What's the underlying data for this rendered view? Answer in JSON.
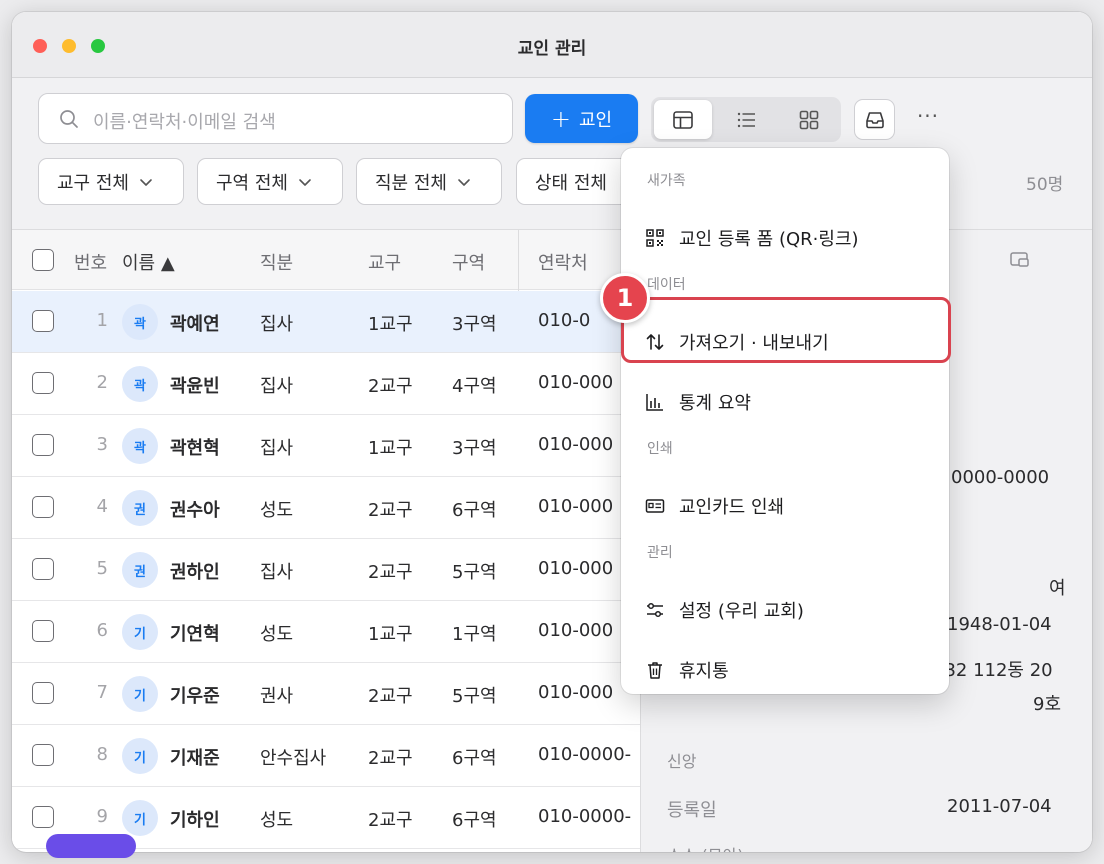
{
  "window": {
    "title": "교인 관리"
  },
  "search": {
    "placeholder": "이름·연락처·이메일 검색"
  },
  "toolbar": {
    "add_label": "교인",
    "more": "···"
  },
  "filters": [
    "교구 전체",
    "구역 전체",
    "직분 전체",
    "상태 전체"
  ],
  "count": "50명",
  "table": {
    "headers": {
      "no": "번호",
      "name": "이름",
      "sort_indicator": "▲",
      "role": "직분",
      "parish": "교구",
      "district": "구역",
      "contact": "연락처"
    },
    "rows": [
      {
        "no": "1",
        "avatar": "곽",
        "name": "곽예연",
        "role": "집사",
        "parish": "1교구",
        "district": "3구역",
        "contact": "010-0",
        "selected": true
      },
      {
        "no": "2",
        "avatar": "곽",
        "name": "곽윤빈",
        "role": "집사",
        "parish": "2교구",
        "district": "4구역",
        "contact": "010-000"
      },
      {
        "no": "3",
        "avatar": "곽",
        "name": "곽현혁",
        "role": "집사",
        "parish": "1교구",
        "district": "3구역",
        "contact": "010-000"
      },
      {
        "no": "4",
        "avatar": "권",
        "name": "권수아",
        "role": "성도",
        "parish": "2교구",
        "district": "6구역",
        "contact": "010-000"
      },
      {
        "no": "5",
        "avatar": "권",
        "name": "권하인",
        "role": "집사",
        "parish": "2교구",
        "district": "5구역",
        "contact": "010-000"
      },
      {
        "no": "6",
        "avatar": "기",
        "name": "기연혁",
        "role": "성도",
        "parish": "1교구",
        "district": "1구역",
        "contact": "010-000"
      },
      {
        "no": "7",
        "avatar": "기",
        "name": "기우준",
        "role": "권사",
        "parish": "2교구",
        "district": "5구역",
        "contact": "010-000"
      },
      {
        "no": "8",
        "avatar": "기",
        "name": "기재준",
        "role": "안수집사",
        "parish": "2교구",
        "district": "6구역",
        "contact": "010-0000-"
      },
      {
        "no": "9",
        "avatar": "기",
        "name": "기하인",
        "role": "성도",
        "parish": "2교구",
        "district": "6구역",
        "contact": "010-0000-"
      }
    ]
  },
  "detail": {
    "phone_partial": "0000-0000",
    "gender": "여",
    "birth": "1948-01-04",
    "address_line1": ". 32 112동 20",
    "address_line2": "9호",
    "faith_label": "신앙",
    "registered_label": "등록일",
    "registered_value": "2011-07-04",
    "next_label_partial": "소소 (모아)"
  },
  "menu": {
    "sections": {
      "new_family": "새가족",
      "data": "데이터",
      "print": "인쇄",
      "manage": "관리"
    },
    "items": {
      "register_form": "교인 등록 폼 (QR·링크)",
      "import_export": "가져오기 · 내보내기",
      "stats": "통계 요약",
      "card_print": "교인카드 인쇄",
      "settings": "설정 (우리 교회)",
      "trash": "휴지통"
    }
  },
  "annotation": {
    "step": "1",
    "color": "#d9434f"
  },
  "colors": {
    "accent": "#1a7cf2",
    "highlight": "#d9434f"
  }
}
